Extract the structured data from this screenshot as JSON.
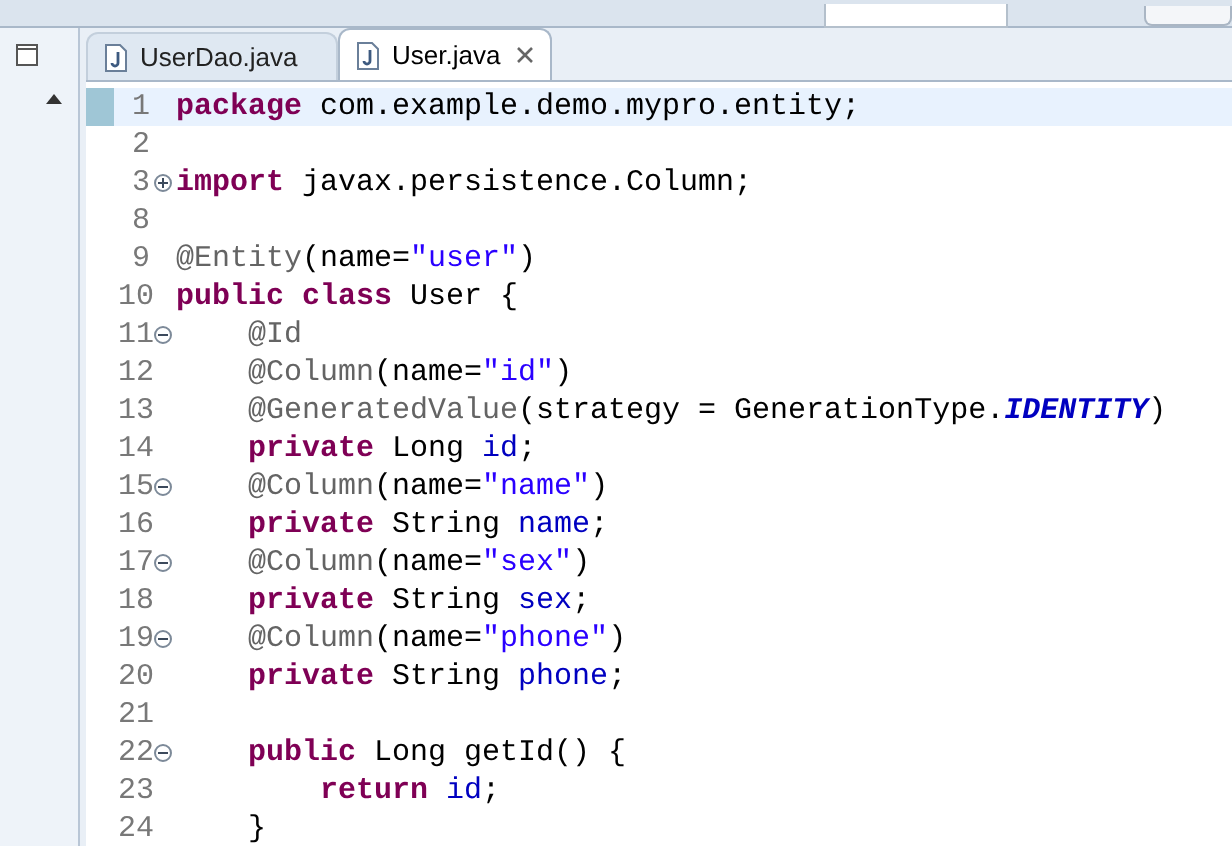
{
  "tabs": [
    {
      "label": "UserDao.java",
      "selected": false
    },
    {
      "label": "User.java",
      "selected": true
    }
  ],
  "editor": {
    "lines": [
      {
        "number": "1",
        "current": true,
        "tokens": [
          {
            "kind": "kw",
            "text": "package"
          },
          {
            "kind": "plain",
            "text": " com.example.demo.mypro.entity;"
          }
        ]
      },
      {
        "number": "2",
        "current": false
      },
      {
        "number": "3",
        "current": false,
        "folded": true,
        "tokens": [
          {
            "kind": "kw",
            "text": "import"
          },
          {
            "kind": "plain",
            "text": " javax.persistence.Column;"
          }
        ]
      },
      {
        "number": "8",
        "current": false
      },
      {
        "number": "9",
        "current": false,
        "tokens": [
          {
            "kind": "ann",
            "text": "@Entity"
          },
          {
            "kind": "plain",
            "text": "(name="
          },
          {
            "kind": "str",
            "text": "\"user\""
          },
          {
            "kind": "plain",
            "text": ")"
          }
        ]
      },
      {
        "number": "10",
        "current": false,
        "tokens": [
          {
            "kind": "kw",
            "text": "public"
          },
          {
            "kind": "kw",
            "text": " class"
          },
          {
            "kind": "plain",
            "text": " User {"
          }
        ]
      },
      {
        "number": "11",
        "current": false,
        "folded": false,
        "tokens": [
          {
            "kind": "ann",
            "text": "    @Id"
          }
        ]
      },
      {
        "number": "12",
        "current": false,
        "tokens": [
          {
            "kind": "ann",
            "text": "    @Column"
          },
          {
            "kind": "plain",
            "text": "(name="
          },
          {
            "kind": "str",
            "text": "\"id\""
          },
          {
            "kind": "plain",
            "text": ")"
          }
        ]
      },
      {
        "number": "13",
        "current": false,
        "tokens": [
          {
            "kind": "ann",
            "text": "    @GeneratedValue"
          },
          {
            "kind": "plain",
            "text": "(strategy = GenerationType."
          },
          {
            "kind": "const",
            "text": "IDENTITY"
          },
          {
            "kind": "plain",
            "text": ")"
          }
        ]
      },
      {
        "number": "14",
        "current": false,
        "tokens": [
          {
            "kind": "kw",
            "text": "    private"
          },
          {
            "kind": "plain",
            "text": " Long "
          },
          {
            "kind": "field",
            "text": "id"
          },
          {
            "kind": "plain",
            "text": ";"
          }
        ]
      },
      {
        "number": "15",
        "current": false,
        "folded": false,
        "tokens": [
          {
            "kind": "ann",
            "text": "    @Column"
          },
          {
            "kind": "plain",
            "text": "(name="
          },
          {
            "kind": "str",
            "text": "\"name\""
          },
          {
            "kind": "plain",
            "text": ")"
          }
        ]
      },
      {
        "number": "16",
        "current": false,
        "tokens": [
          {
            "kind": "kw",
            "text": "    private"
          },
          {
            "kind": "plain",
            "text": " String "
          },
          {
            "kind": "field",
            "text": "name"
          },
          {
            "kind": "plain",
            "text": ";"
          }
        ]
      },
      {
        "number": "17",
        "current": false,
        "folded": false,
        "tokens": [
          {
            "kind": "ann",
            "text": "    @Column"
          },
          {
            "kind": "plain",
            "text": "(name="
          },
          {
            "kind": "str",
            "text": "\"sex\""
          },
          {
            "kind": "plain",
            "text": ")"
          }
        ]
      },
      {
        "number": "18",
        "current": false,
        "tokens": [
          {
            "kind": "kw",
            "text": "    private"
          },
          {
            "kind": "plain",
            "text": " String "
          },
          {
            "kind": "field",
            "text": "sex"
          },
          {
            "kind": "plain",
            "text": ";"
          }
        ]
      },
      {
        "number": "19",
        "current": false,
        "folded": false,
        "tokens": [
          {
            "kind": "ann",
            "text": "    @Column"
          },
          {
            "kind": "plain",
            "text": "(name="
          },
          {
            "kind": "str",
            "text": "\"phone\""
          },
          {
            "kind": "plain",
            "text": ")"
          }
        ]
      },
      {
        "number": "20",
        "current": false,
        "tokens": [
          {
            "kind": "kw",
            "text": "    private"
          },
          {
            "kind": "plain",
            "text": " String "
          },
          {
            "kind": "field",
            "text": "phone"
          },
          {
            "kind": "plain",
            "text": ";"
          }
        ]
      },
      {
        "number": "21",
        "current": false
      },
      {
        "number": "22",
        "current": false,
        "folded": false,
        "tokens": [
          {
            "kind": "kw",
            "text": "    public"
          },
          {
            "kind": "plain",
            "text": " Long getId() {"
          }
        ]
      },
      {
        "number": "23",
        "current": false,
        "tokens": [
          {
            "kind": "kw",
            "text": "        return"
          },
          {
            "kind": "field",
            "text": " id"
          },
          {
            "kind": "plain",
            "text": ";"
          }
        ]
      },
      {
        "number": "24",
        "current": false,
        "tokens": [
          {
            "kind": "plain",
            "text": "    }"
          }
        ]
      }
    ]
  }
}
